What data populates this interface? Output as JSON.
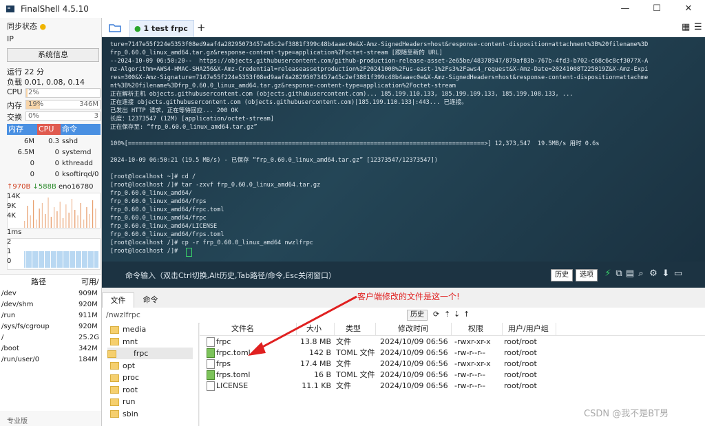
{
  "window": {
    "title": "FinalShell 4.5.10",
    "minimize": "—",
    "maximize": "☐",
    "close": "✕"
  },
  "left_panel": {
    "sync_status": "同步状态",
    "ip_label": "IP",
    "sysinfo_button": "系统信息",
    "uptime": "运行 22 分",
    "load": "负载 0.01, 0.08, 0.14",
    "meters": [
      {
        "label": "CPU",
        "pct": "2%",
        "value": "",
        "fill": 0.02
      },
      {
        "label": "内存",
        "pct": "19%",
        "value": "346M",
        "fill": 0.19
      },
      {
        "label": "交换",
        "pct": "0%",
        "value": "3",
        "fill": 0.0
      }
    ],
    "process_header": {
      "mem": "内存",
      "cpu": "CPU",
      "cmd": "命令"
    },
    "processes": [
      {
        "mem": "6M",
        "cpu": "0.3",
        "cmd": "sshd"
      },
      {
        "mem": "6.5M",
        "cpu": "0",
        "cmd": "systemd"
      },
      {
        "mem": "0",
        "cpu": "0",
        "cmd": "kthreadd"
      },
      {
        "mem": "0",
        "cpu": "0",
        "cmd": "ksoftirqd/0"
      }
    ],
    "net": {
      "up": "↑970B",
      "down": "↓588B",
      "iface": "eno16780"
    },
    "net_scale": [
      "14K",
      "9K",
      "4K"
    ],
    "latency_scale": [
      "1ms",
      "2",
      "1",
      "0"
    ],
    "disk_header": {
      "path": "路径",
      "avail": "可用/"
    },
    "disks": [
      {
        "path": "/dev",
        "size": "909M"
      },
      {
        "path": "/dev/shm",
        "size": "920M"
      },
      {
        "path": "/run",
        "size": "911M"
      },
      {
        "path": "/sys/fs/cgroup",
        "size": "920M"
      },
      {
        "path": "/",
        "size": "25.2G"
      },
      {
        "path": "/boot",
        "size": "342M"
      },
      {
        "path": "/run/user/0",
        "size": "184M"
      }
    ],
    "footer": "专业版"
  },
  "tabs": {
    "active_label": "1 test frpc",
    "add": "+"
  },
  "terminal": {
    "lines": [
      "ture=7147e55f224e5353f08ed9aaf4a28295073457a45c2ef3881f399c48b4aaec0e&X-Amz-SignedHeaders=host&response-content-disposition=attachment%3B%20filename%3D",
      "frp_0.60.0_linux_amd64.tar.gz&response-content-type=application%2Foctet-stream [跟随至新的 URL]",
      "--2024-10-09 06:50:20--  https://objects.githubusercontent.com/github-production-release-asset-2e65be/48378947/879af83b-767b-4fd3-b702-c68c6c8cf307?X-A",
      "mz-Algorithm=AWS4-HMAC-SHA256&X-Amz-Credential=releaseassetproduction%2F20241008%2Fus-east-1%2Fs3%2Faws4_request&X-Amz-Date=20241008T225019Z&X-Amz-Expi",
      "res=300&X-Amz-Signature=7147e55f224e5353f08ed9aaf4a28295073457a45c2ef3881f399c48b4aaec0e&X-Amz-SignedHeaders=host&response-content-disposition=attachme",
      "nt%3B%20filename%3Dfrp_0.60.0_linux_amd64.tar.gz&response-content-type=application%2Foctet-stream",
      "正在解析主机 objects.githubusercontent.com (objects.githubusercontent.com)... 185.199.110.133, 185.199.109.133, 185.199.108.133, ...",
      "正在连接 objects.githubusercontent.com (objects.githubusercontent.com)|185.199.110.133|:443... 已连接。",
      "已发出 HTTP 请求，正在等待回应... 200 OK",
      "长度：12373547 (12M) [application/octet-stream]",
      "正在保存至: “frp_0.60.0_linux_amd64.tar.gz”",
      "",
      "100%[====================================================================================================>] 12,373,547  19.5MB/s 用时 0.6s",
      "",
      "2024-10-09 06:50:21 (19.5 MB/s) - 已保存 “frp_0.60.0_linux_amd64.tar.gz” [12373547/12373547])",
      "",
      "[root@localhost ~]# cd /",
      "[root@localhost /]# tar -zxvf frp_0.60.0_linux_amd64.tar.gz",
      "frp_0.60.0_linux_amd64/",
      "frp_0.60.0_linux_amd64/frps",
      "frp_0.60.0_linux_amd64/frpc.toml",
      "frp_0.60.0_linux_amd64/frpc",
      "frp_0.60.0_linux_amd64/LICENSE",
      "frp_0.60.0_linux_amd64/frps.toml",
      "[root@localhost /]# cp -r frp_0.60.0_linux_amd64 nwzlfrpc",
      "[root@localhost /]# "
    ]
  },
  "command_bar": {
    "hint": "命令输入（双击Ctrl切换,Alt历史,Tab路径/命令,Esc关闭窗口）",
    "history": "历史",
    "options": "选项"
  },
  "file_tabs": {
    "files": "文件",
    "commands": "命令"
  },
  "path": {
    "value": "/nwzlfrpc",
    "history": "历史"
  },
  "tree": [
    "media",
    "mnt",
    "frpc",
    "opt",
    "proc",
    "root",
    "run",
    "sbin"
  ],
  "file_columns": {
    "name": "文件名",
    "size": "大小",
    "type": "类型",
    "mtime": "修改时间",
    "perm": "权限",
    "owner": "用户/用户组"
  },
  "files": [
    {
      "name": "frpc",
      "size": "13.8 MB",
      "type": "文件",
      "mtime": "2024/10/09 06:56",
      "perm": "-rwxr-xr-x",
      "owner": "root/root",
      "icon": "file"
    },
    {
      "name": "frpc.toml",
      "size": "142 B",
      "type": "TOML 文件",
      "mtime": "2024/10/09 06:56",
      "perm": "-rw-r--r--",
      "owner": "root/root",
      "icon": "toml"
    },
    {
      "name": "frps",
      "size": "17.4 MB",
      "type": "文件",
      "mtime": "2024/10/09 06:56",
      "perm": "-rwxr-xr-x",
      "owner": "root/root",
      "icon": "file"
    },
    {
      "name": "frps.toml",
      "size": "16 B",
      "type": "TOML 文件",
      "mtime": "2024/10/09 06:56",
      "perm": "-rw-r--r--",
      "owner": "root/root",
      "icon": "toml"
    },
    {
      "name": "LICENSE",
      "size": "11.1 KB",
      "type": "文件",
      "mtime": "2024/10/09 06:56",
      "perm": "-rw-r--r--",
      "owner": "root/root",
      "icon": "file"
    }
  ],
  "annotation": "客户端修改的文件是这一个!",
  "watermark": "CSDN @我不是BT男",
  "colors": {
    "terminal_bg": "#1f3a49",
    "accent": "#e02020",
    "proc_header": "#4a90e2",
    "proc_cpu_header": "#e05a4f"
  }
}
